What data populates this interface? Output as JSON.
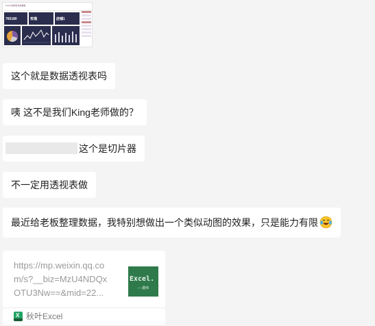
{
  "thumbnail": {
    "title": "Power透视表动态看板",
    "kpis": [
      {
        "label": "",
        "value": "765180"
      },
      {
        "label": "",
        "value": "攻瑰"
      },
      {
        "label": "",
        "value": "店铺1"
      }
    ]
  },
  "messages": [
    {
      "id": "m1",
      "text": "这个就是数据透视表吗"
    },
    {
      "id": "m2",
      "text": "咦 这不是我们King老师做的？"
    },
    {
      "id": "m3",
      "text": "这个是切片器"
    },
    {
      "id": "m4",
      "text": "不一定用透视表做"
    },
    {
      "id": "m5",
      "text": "最近给老板整理数据，我特别想做出一个类似动图的效果，只是能力有限"
    }
  ],
  "link_card": {
    "url_lines": [
      "https://mp.weixin.qq.co",
      "m/s?__biz=MzU4NDQx",
      "OTU3Nw==&mid=22..."
    ],
    "cover_text": "Excel.",
    "cover_sub": "— 趣味",
    "source_name": "秋叶Excel",
    "source_icon_letter": "X"
  },
  "icons": {
    "emoji": "laughing-tears-emoji",
    "source": "excel-app-icon"
  }
}
